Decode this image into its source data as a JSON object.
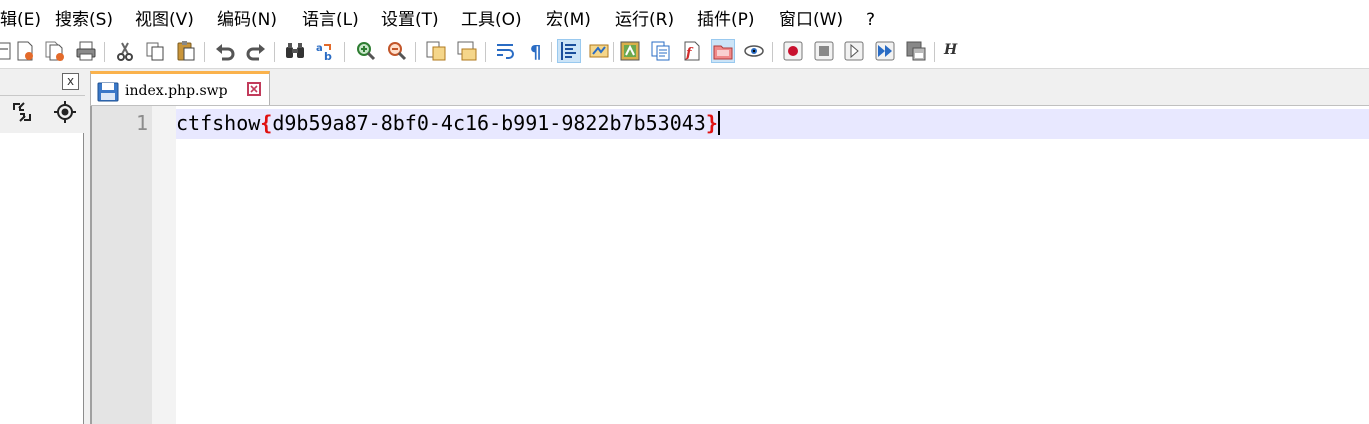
{
  "menu": [
    {
      "key": "edit",
      "label": "辑(E)"
    },
    {
      "key": "search",
      "label": "搜索(S)"
    },
    {
      "key": "view",
      "label": "视图(V)"
    },
    {
      "key": "encoding",
      "label": "编码(N)"
    },
    {
      "key": "language",
      "label": "语言(L)"
    },
    {
      "key": "settings",
      "label": "设置(T)"
    },
    {
      "key": "tools",
      "label": "工具(O)"
    },
    {
      "key": "macro",
      "label": "宏(M)"
    },
    {
      "key": "run",
      "label": "运行(R)"
    },
    {
      "key": "plugins",
      "label": "插件(P)"
    },
    {
      "key": "window",
      "label": "窗口(W)"
    },
    {
      "key": "help",
      "label": "?"
    }
  ],
  "toolbar": {
    "icons": [
      "open-file-icon",
      "close-file-icon",
      "close-all-icon",
      "print-icon",
      "cut-icon",
      "copy-icon",
      "paste-icon",
      "undo-icon",
      "redo-icon",
      "find-icon",
      "replace-icon",
      "zoom-in-icon",
      "zoom-out-icon",
      "sync-vertical-icon",
      "sync-horizontal-icon",
      "word-wrap-icon",
      "show-all-characters-icon",
      "indent-guide-icon",
      "function-list-icon",
      "document-map-icon",
      "clipboard-history-icon",
      "language-icon",
      "folder-as-workspace-icon",
      "monitoring-icon",
      "macro-record-icon",
      "macro-stop-icon",
      "macro-play-icon",
      "macro-run-multiple-icon",
      "macro-save-icon"
    ],
    "hex_label": "H",
    "accent": "#fab24c"
  },
  "panel": {
    "close_symbol": "x"
  },
  "tab": {
    "filename": "index.php.swp",
    "close_color": "#c23b5b"
  },
  "editor": {
    "line_number": "1",
    "prefix": "ctfshow",
    "brace_open": "{",
    "flag_body": "d9b59a87-8bf0-4c16-b991-9822b7b53043",
    "brace_close": "}",
    "brace_color": "#e01010",
    "current_line_color": "#e8e8ff"
  }
}
